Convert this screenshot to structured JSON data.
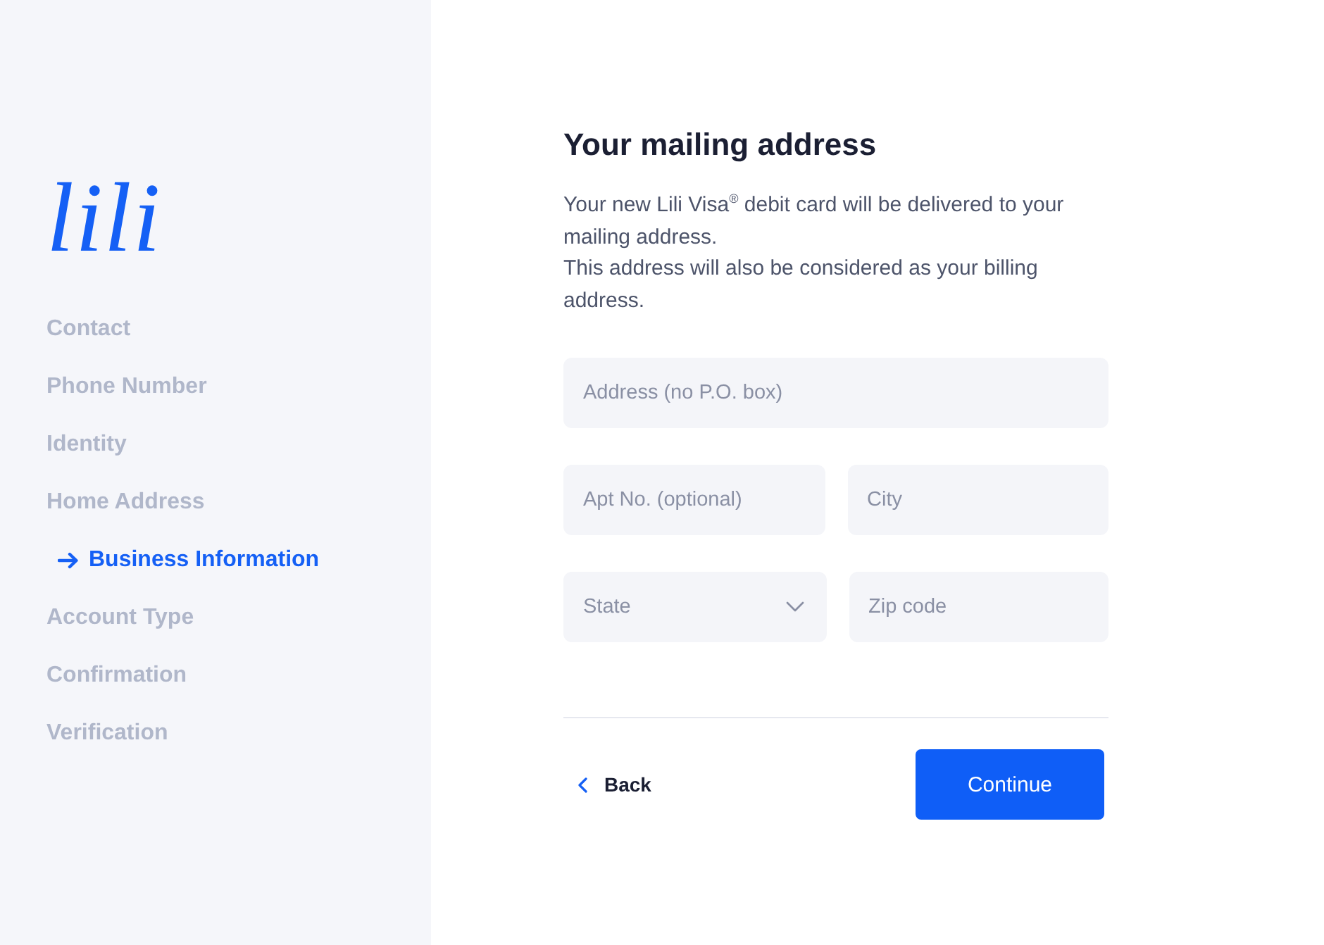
{
  "logo": {
    "text": "lili"
  },
  "steps": [
    {
      "label": "Contact",
      "selected": false
    },
    {
      "label": "Phone Number",
      "selected": false
    },
    {
      "label": "Identity",
      "selected": false
    },
    {
      "label": "Home Address",
      "selected": false
    },
    {
      "label": "Business Information",
      "selected": true
    },
    {
      "label": "Account Type",
      "selected": false
    },
    {
      "label": "Confirmation",
      "selected": false
    },
    {
      "label": "Verification",
      "selected": false
    }
  ],
  "form": {
    "title": "Your mailing address",
    "paragraphs": [
      "Your new Lili Visa$^{®}$ debit card will be delivered to your mailing address.",
      "This address will also be considered as your billing address."
    ],
    "field_rows": [
      [
        {
          "kind": "text",
          "placeholder": "Address (no P.O. box)"
        }
      ],
      [
        {
          "kind": "text",
          "placeholder": "Apt No. (optional)"
        },
        {
          "kind": "text",
          "placeholder": "City"
        }
      ],
      [
        {
          "kind": "select",
          "placeholder": "State"
        },
        {
          "kind": "text",
          "placeholder": "Zip code"
        }
      ]
    ]
  },
  "actions": [
    {
      "kind": "back",
      "label": "Back"
    },
    {
      "kind": "primary",
      "label": "Continue"
    }
  ]
}
